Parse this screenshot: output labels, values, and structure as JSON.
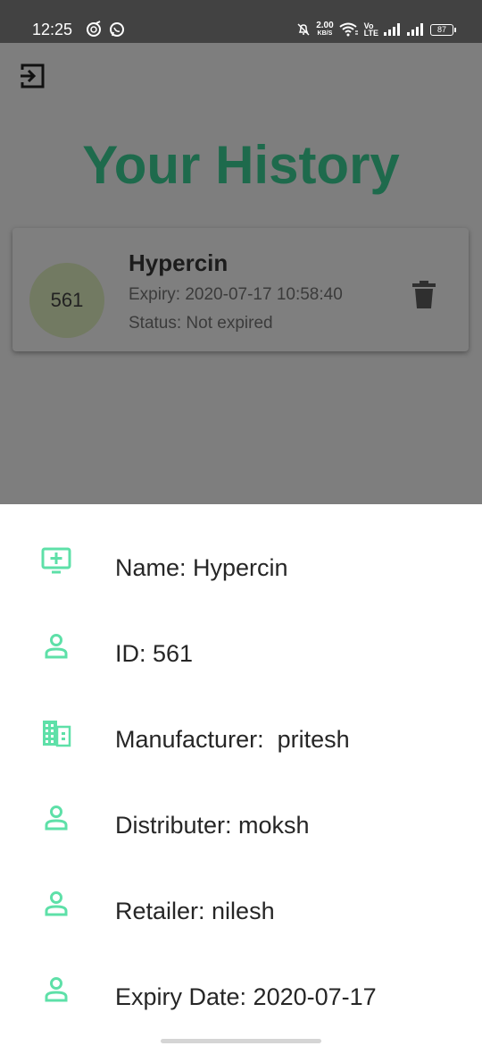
{
  "status_bar": {
    "time": "12:25",
    "net_speed_value": "2.00",
    "net_speed_unit": "KB/S",
    "volte_top": "Vo",
    "volte_bottom": "LTE",
    "battery": "87"
  },
  "header": {
    "title": "Your History",
    "logout_icon": "logout-icon"
  },
  "history_card": {
    "id_badge": "561",
    "name": "Hypercin",
    "expiry": "Expiry: 2020-07-17 10:58:40",
    "status": "Status: Not expired",
    "delete_icon": "trash-icon"
  },
  "details_sheet": {
    "rows": [
      {
        "icon": "medical-monitor-icon",
        "text": "Name: Hypercin"
      },
      {
        "icon": "person-icon",
        "text": "ID: 561"
      },
      {
        "icon": "building-icon",
        "text": "Manufacturer:  pritesh"
      },
      {
        "icon": "person-icon",
        "text": "Distributer: moksh"
      },
      {
        "icon": "person-icon",
        "text": "Retailer: nilesh"
      },
      {
        "icon": "person-icon",
        "text": "Expiry Date: 2020-07-17"
      }
    ]
  },
  "colors": {
    "title_green": "#1e6a4c",
    "icon_mint": "#5ee0a8",
    "scrim_gray": "#7e7e7e"
  }
}
